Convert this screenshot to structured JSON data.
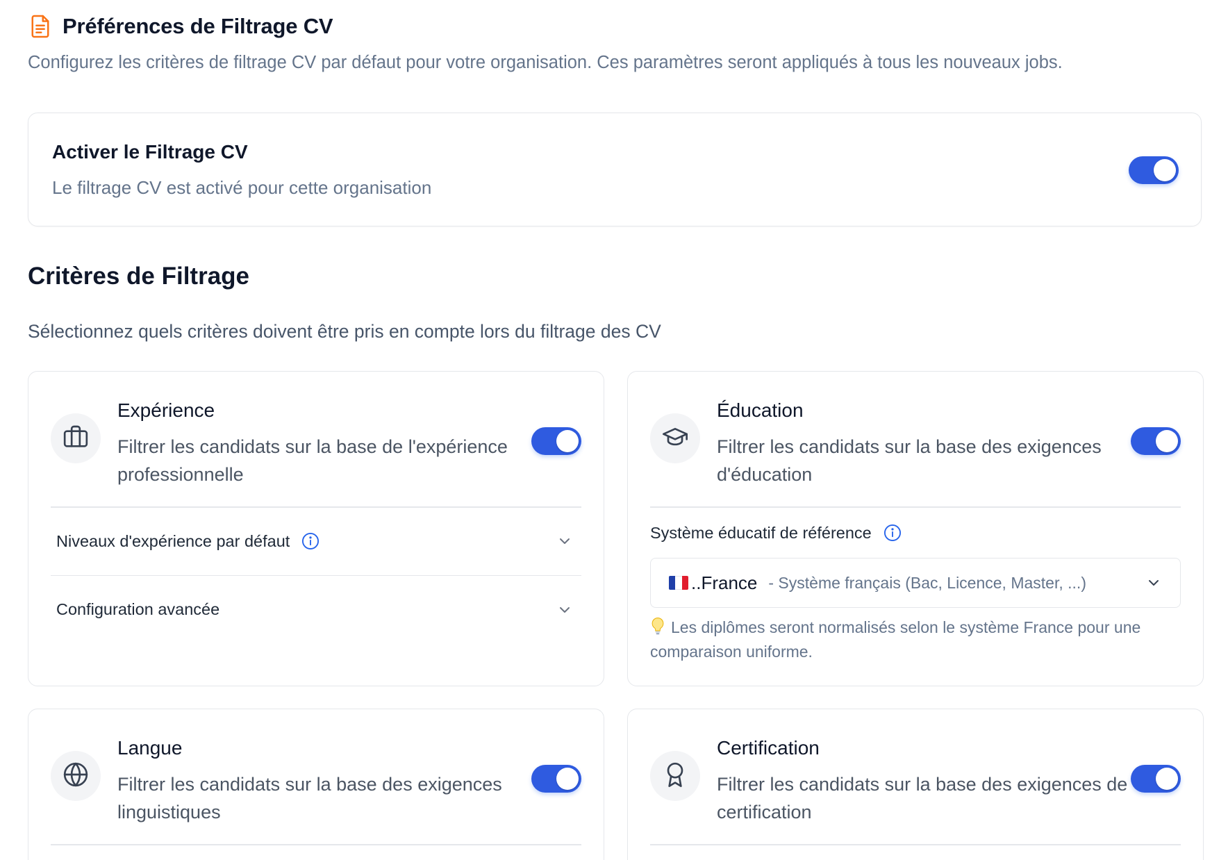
{
  "header": {
    "icon": "document-icon",
    "title": "Préférences de Filtrage CV",
    "subtitle": "Configurez les critères de filtrage CV par défaut pour votre organisation. Ces paramètres seront appliqués à tous les nouveaux jobs."
  },
  "activation": {
    "title": "Activer le Filtrage CV",
    "description": "Le filtrage CV est activé pour cette organisation",
    "enabled": true
  },
  "criteria": {
    "title": "Critères de Filtrage",
    "description": "Sélectionnez quels critères doivent être pris en compte lors du filtrage des CV",
    "experience": {
      "icon": "briefcase-icon",
      "title": "Expérience",
      "description": "Filtrer les candidats sur la base de l'expérience professionnelle",
      "enabled": true,
      "levels_label": "Niveaux d'expérience par défaut",
      "advanced_label": "Configuration avancée"
    },
    "education": {
      "icon": "graduation-cap-icon",
      "title": "Éducation",
      "description": "Filtrer les candidats sur la base des exigences d'éducation",
      "enabled": true,
      "system_label": "Système éducatif de référence",
      "selected_value": "..France",
      "selected_detail": "- Système français (Bac, Licence, Master, ...)",
      "hint": "Les diplômes seront normalisés selon le système France pour une comparaison uniforme."
    },
    "language": {
      "icon": "globe-icon",
      "title": "Langue",
      "description": "Filtrer les candidats sur la base des exigences linguistiques",
      "enabled": true
    },
    "certification": {
      "icon": "award-icon",
      "title": "Certification",
      "description": "Filtrer les candidats sur la base des exigences de certification",
      "enabled": true
    }
  },
  "colors": {
    "accent": "#2f5be0",
    "icon_orange": "#f97316",
    "info_blue": "#2563eb"
  }
}
